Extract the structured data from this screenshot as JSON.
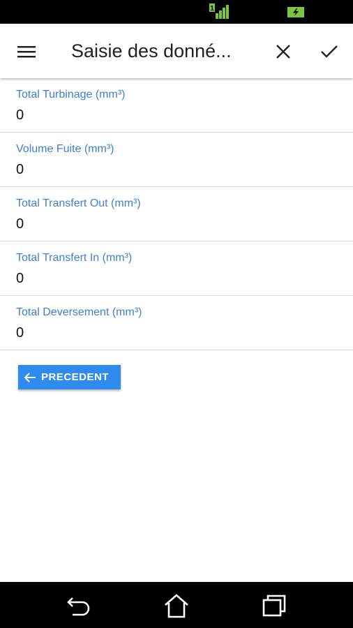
{
  "app_bar": {
    "title": "Saisie des donné..."
  },
  "form": {
    "fields": [
      {
        "label": "Total Turbinage (mm³)",
        "value": "0"
      },
      {
        "label": "Volume Fuite (mm³)",
        "value": "0"
      },
      {
        "label": "Total Transfert Out (mm³)",
        "value": "0"
      },
      {
        "label": "Total Transfert In (mm³)",
        "value": "0"
      },
      {
        "label": "Total Deversement (mm³)",
        "value": "0"
      }
    ]
  },
  "buttons": {
    "previous_label": "PRECEDENT"
  },
  "colors": {
    "accent": "#2f8bf0",
    "label": "#3f7fcf",
    "status_icon": "#7cc440"
  },
  "status_bar": {
    "signal_digit": "1"
  },
  "icons": {
    "menu": "hamburger-icon",
    "close": "close-icon",
    "confirm": "check-icon",
    "previous": "arrow-left-icon",
    "nav_back": "back-icon",
    "nav_home": "home-icon",
    "nav_recents": "recents-icon"
  }
}
